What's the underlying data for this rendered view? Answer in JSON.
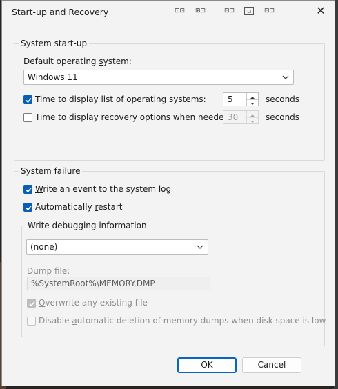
{
  "window": {
    "title": "Start-up and Recovery"
  },
  "system_startup": {
    "legend": "System start-up",
    "default_os_label": "Default operating system:",
    "default_os_value": "Windows 11",
    "display_list": {
      "label": "Time to display list of operating systems:",
      "checked": true,
      "value": "5",
      "unit": "seconds"
    },
    "recovery": {
      "label": "Time to display recovery options when needed:",
      "checked": false,
      "value": "30",
      "unit": "seconds"
    }
  },
  "system_failure": {
    "legend": "System failure",
    "write_event": {
      "label": "Write an event to the system log",
      "checked": true
    },
    "auto_restart": {
      "label": "Automatically restart",
      "checked": true
    },
    "debug": {
      "legend": "Write debugging information",
      "selected": "(none)",
      "dump_label": "Dump file:",
      "dump_value": "%SystemRoot%\\MEMORY.DMP",
      "overwrite": {
        "label": "Overwrite any existing file",
        "checked": true
      },
      "disable_auto_delete": {
        "label": "Disable automatic deletion of memory dumps when disk space is low",
        "checked": false
      }
    }
  },
  "buttons": {
    "ok": "OK",
    "cancel": "Cancel"
  },
  "colors": {
    "accent": "#0a5fb4",
    "window_bg": "#f3f3f3"
  }
}
